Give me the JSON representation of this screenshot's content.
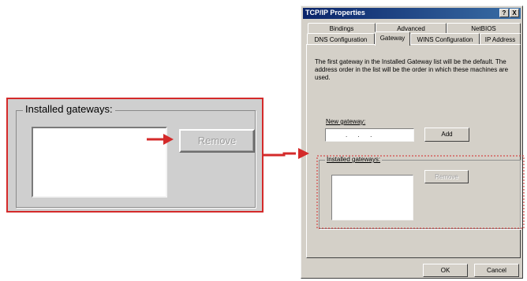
{
  "callout": {
    "group_label": "Installed gateways:",
    "remove_label": "Remove",
    "accent_color": "#d42a2a"
  },
  "dialog": {
    "title": "TCP/IP Properties",
    "help_btn": "?",
    "close_btn": "X",
    "tabs_back": [
      "Bindings",
      "Advanced",
      "NetBIOS"
    ],
    "tabs_front": [
      "DNS Configuration",
      "Gateway",
      "WINS Configuration",
      "IP Address"
    ],
    "active_tab": "Gateway",
    "description": "The first gateway in the Installed Gateway list will be the default. The address order in the list will be the order in which these machines are used.",
    "new_gateway_label": "New gateway:",
    "ip_dots": ".      .      .",
    "add_label": "Add",
    "installed_label": "Installed gateways:",
    "remove_label": "Remove",
    "ok_label": "OK",
    "cancel_label": "Cancel"
  }
}
